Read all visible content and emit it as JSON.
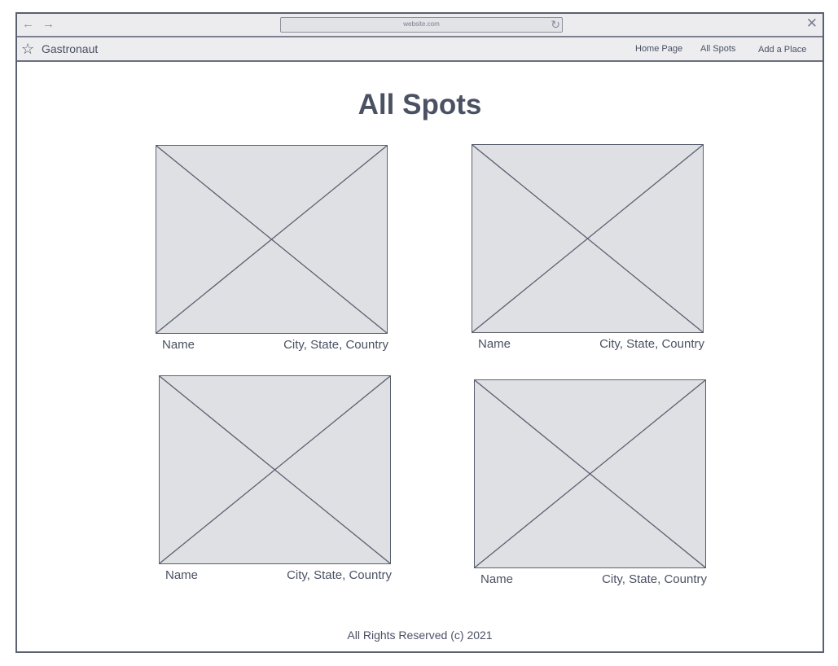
{
  "browser": {
    "url": "website.com",
    "icons": {
      "back": "arrow-left-icon",
      "forward": "arrow-right-icon",
      "reload": "reload-icon",
      "close": "close-icon"
    }
  },
  "header": {
    "logo_icon": "star-icon",
    "brand": "Gastronaut",
    "nav": {
      "home": "Home Page",
      "all_spots": "All Spots",
      "add_place": "Add a Place"
    }
  },
  "main": {
    "title": "All Spots",
    "spots": [
      {
        "name": "Name",
        "location": "City, State, Country"
      },
      {
        "name": "Name",
        "location": "City, State, Country"
      },
      {
        "name": "Name",
        "location": "City, State, Country"
      },
      {
        "name": "Name",
        "location": "City, State, Country"
      }
    ]
  },
  "footer": {
    "text": "All Rights Reserved (c) 2021"
  },
  "colors": {
    "ink": "#4a5163",
    "placeholder_fill": "#dfe0e4",
    "chrome": "#ececef"
  }
}
